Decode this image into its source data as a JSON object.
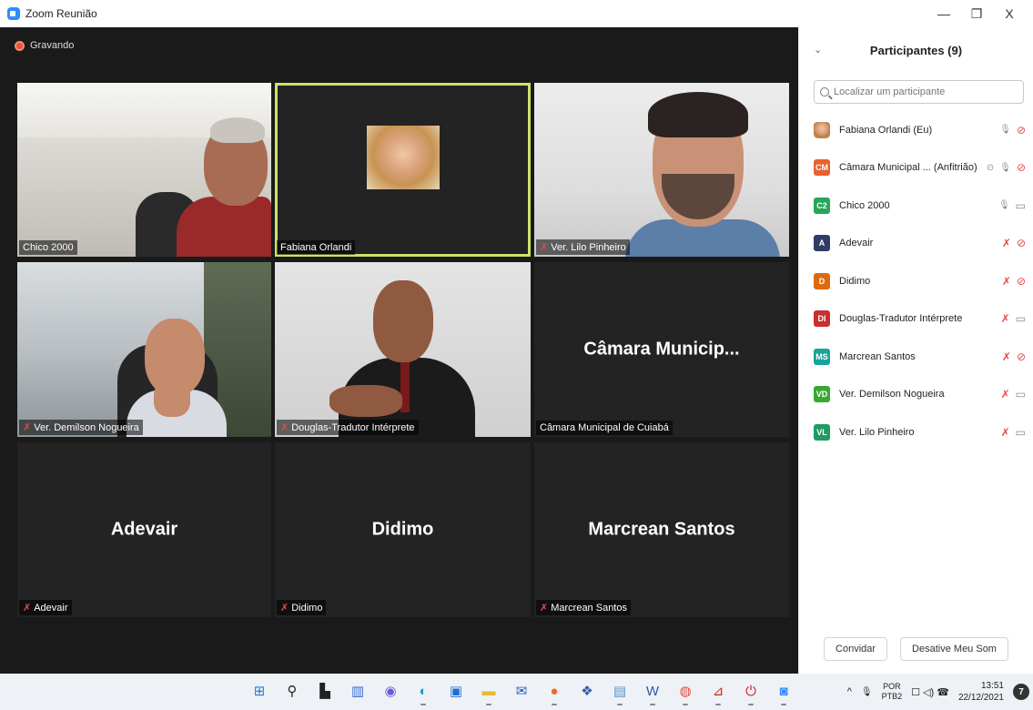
{
  "window": {
    "title": "Zoom Reunião",
    "minimize": "—",
    "maximize": "❐",
    "close": "X"
  },
  "recording": {
    "label": "Gravando"
  },
  "tiles": [
    {
      "label": "Chico 2000",
      "muted": false
    },
    {
      "label": "Fabiana Orlandi",
      "muted": false
    },
    {
      "label": "Ver. Lilo Pinheiro",
      "muted": true
    },
    {
      "label": "Ver. Demilson Nogueira",
      "muted": true
    },
    {
      "label": "Douglas-Tradutor Intérprete",
      "muted": true
    },
    {
      "label": "Câmara Municipal de Cuiabá",
      "big_name": "Câmara Municip...",
      "muted": false
    },
    {
      "label": "Adevair",
      "big_name": "Adevair",
      "muted": true
    },
    {
      "label": "Didimo",
      "big_name": "Didimo",
      "muted": true
    },
    {
      "label": "Marcrean Santos",
      "big_name": "Marcrean Santos",
      "muted": true
    }
  ],
  "sidebar": {
    "title": "Participantes (9)",
    "collapse_icon": "⌄",
    "search_placeholder": "Localizar um participante",
    "participants": [
      {
        "name": "Fabiana Orlandi (Eu)",
        "initials": "",
        "color": "#c9955a",
        "photo": true,
        "mic": "on",
        "video": "off",
        "host": false
      },
      {
        "name": "Câmara Municipal ... (Anfitrião)",
        "initials": "CM",
        "color": "#e8622f",
        "photo": false,
        "mic": "on",
        "video": "off",
        "host": true
      },
      {
        "name": "Chico 2000",
        "initials": "C2",
        "color": "#26a65b",
        "photo": false,
        "mic": "on",
        "video": "on",
        "host": false
      },
      {
        "name": "Adevair",
        "initials": "A",
        "color": "#2f3d66",
        "photo": false,
        "mic": "off",
        "video": "off",
        "host": false
      },
      {
        "name": "Didimo",
        "initials": "D",
        "color": "#e0690f",
        "photo": false,
        "mic": "off",
        "video": "off",
        "host": false
      },
      {
        "name": "Douglas-Tradutor Intérprete",
        "initials": "DI",
        "color": "#c8302f",
        "photo": false,
        "mic": "off",
        "video": "on",
        "host": false
      },
      {
        "name": "Marcrean Santos",
        "initials": "MS",
        "color": "#1aa398",
        "photo": false,
        "mic": "off",
        "video": "off",
        "host": false
      },
      {
        "name": "Ver. Demilson Nogueira",
        "initials": "VD",
        "color": "#38a82e",
        "photo": false,
        "mic": "off",
        "video": "on",
        "host": false
      },
      {
        "name": "Ver. Lilo Pinheiro",
        "initials": "VL",
        "color": "#1f9c63",
        "photo": false,
        "mic": "off",
        "video": "on",
        "host": false
      }
    ],
    "invite_label": "Convidar",
    "mute_me_label": "Desative Meu Som"
  },
  "taskbar": {
    "apps": [
      {
        "name": "start-icon",
        "glyph": "⊞",
        "color": "#1c7ce0",
        "running": false
      },
      {
        "name": "search-icon",
        "glyph": "⚲",
        "color": "#222222",
        "running": false
      },
      {
        "name": "task-view-icon",
        "glyph": "▙",
        "color": "#222222",
        "running": false
      },
      {
        "name": "widgets-icon",
        "glyph": "▥",
        "color": "#2e6fd1",
        "running": false
      },
      {
        "name": "chat-icon",
        "glyph": "◉",
        "color": "#6a5ad8",
        "running": false
      },
      {
        "name": "edge-icon",
        "glyph": "◐",
        "color": "#1b9bd8",
        "running": true
      },
      {
        "name": "store-icon",
        "glyph": "▣",
        "color": "#1d6fd2",
        "running": false
      },
      {
        "name": "folder-icon",
        "glyph": "▬",
        "color": "#e9b933",
        "running": true
      },
      {
        "name": "mail-icon",
        "glyph": "✉",
        "color": "#1f5fbf",
        "running": false
      },
      {
        "name": "firefox-icon",
        "glyph": "●",
        "color": "#f06a2b",
        "running": true
      },
      {
        "name": "dropbox-icon",
        "glyph": "❖",
        "color": "#2f5aa5",
        "running": false
      },
      {
        "name": "scanner-icon",
        "glyph": "▤",
        "color": "#5b8fc9",
        "running": true
      },
      {
        "name": "word-icon",
        "glyph": "W",
        "color": "#2a5ab1",
        "running": true
      },
      {
        "name": "chrome-icon",
        "glyph": "◍",
        "color": "#de4b3b",
        "running": true
      },
      {
        "name": "pdf-icon",
        "glyph": "⊿",
        "color": "#d3281e",
        "running": true
      },
      {
        "name": "power-icon",
        "glyph": "⏻",
        "color": "#d41f2f",
        "running": true
      },
      {
        "name": "zoom-icon",
        "glyph": "◙",
        "color": "#2d8cff",
        "running": true
      }
    ],
    "tray": {
      "chevron": "^",
      "mic_glyph": "🎙",
      "lang_top": "POR",
      "lang_bottom": "PTB2",
      "sys_glyphs": "☐ ◁) ☎",
      "time": "13:51",
      "date": "22/12/2021",
      "notifications": "7"
    }
  }
}
